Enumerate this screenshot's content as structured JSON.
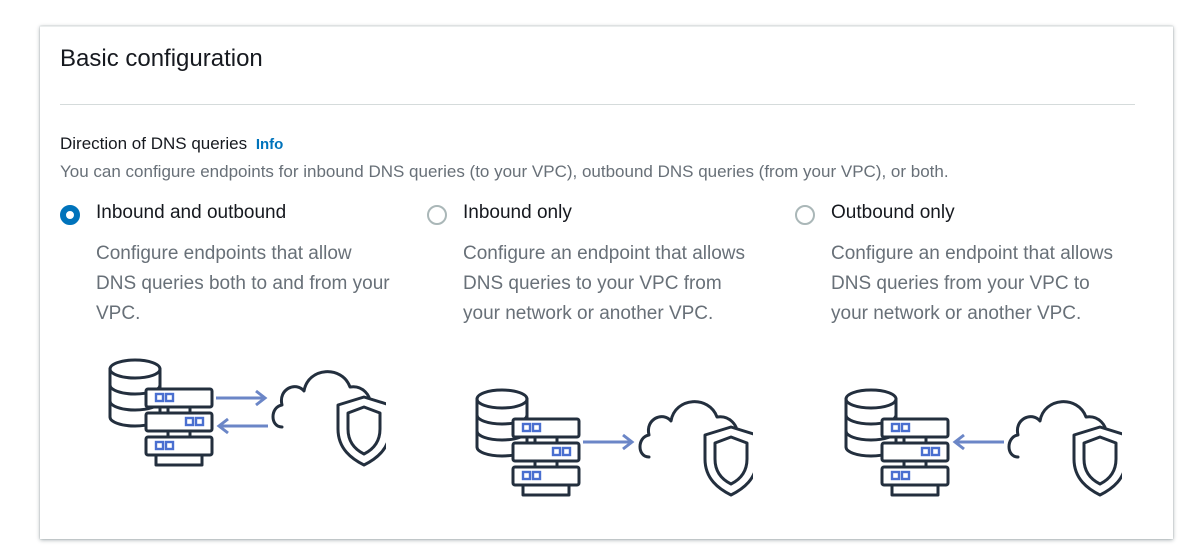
{
  "panel": {
    "title": "Basic configuration"
  },
  "direction": {
    "label": "Direction of DNS queries",
    "info_link": "Info",
    "description": "You can configure endpoints for inbound DNS queries (to your VPC), outbound DNS queries (from your VPC), or both.",
    "selected": "inbound-and-outbound",
    "options": [
      {
        "id": "inbound-and-outbound",
        "label": "Inbound and outbound",
        "description": "Configure endpoints that allow DNS queries both to and from your VPC.",
        "icon": "server-cloud-bidirectional-icon"
      },
      {
        "id": "inbound-only",
        "label": "Inbound only",
        "description": "Configure an endpoint that allows DNS queries to your VPC from your network or another VPC.",
        "icon": "server-cloud-outward-arrow-icon"
      },
      {
        "id": "outbound-only",
        "label": "Outbound only",
        "description": "Configure an endpoint that allows DNS queries from your VPC to your network or another VPC.",
        "icon": "server-cloud-inward-arrow-icon"
      }
    ]
  },
  "colors": {
    "accent": "#0073bb",
    "arrow": "#6b86c7",
    "icon_ink": "#232f3e",
    "muted_text": "#687078"
  }
}
